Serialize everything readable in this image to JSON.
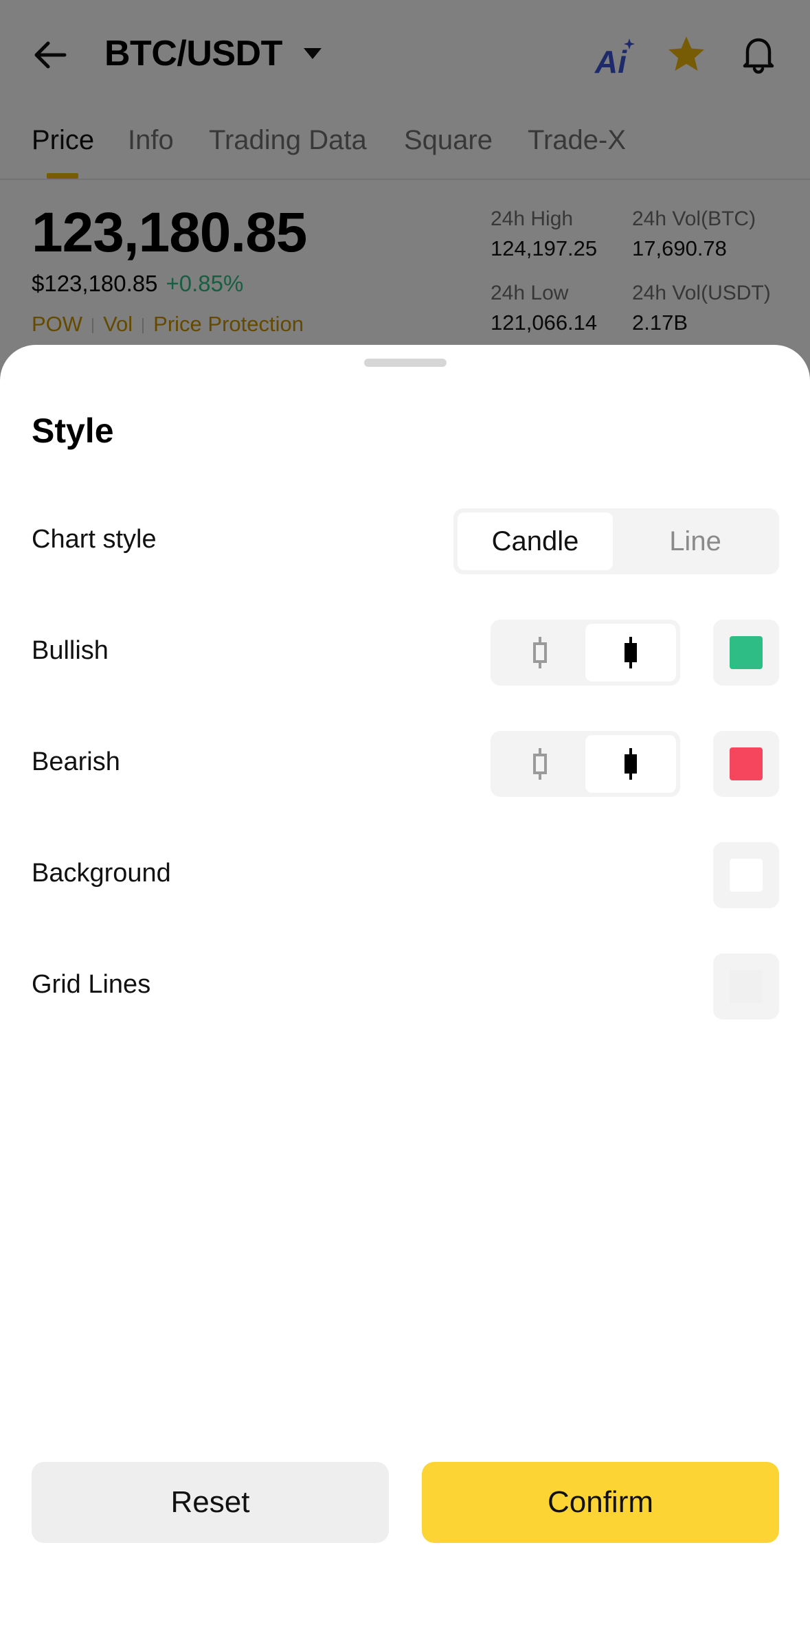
{
  "header": {
    "pair": "BTC/USDT",
    "icons": [
      "back-arrow-icon",
      "caret-down-icon",
      "ai-icon",
      "star-icon",
      "bell-icon"
    ]
  },
  "tabs": [
    {
      "label": "Price",
      "active": true
    },
    {
      "label": "Info",
      "active": false
    },
    {
      "label": "Trading Data",
      "active": false
    },
    {
      "label": "Square",
      "active": false
    },
    {
      "label": "Trade-X",
      "active": false
    }
  ],
  "ticker": {
    "last_price": "123,180.85",
    "fiat_price": "$123,180.85",
    "change": "+0.85%",
    "tags": [
      "POW",
      "Vol",
      "Price Protection"
    ],
    "stats": {
      "high_label": "24h High",
      "high_value": "124,197.25",
      "vol_btc_label": "24h Vol(BTC)",
      "vol_btc_value": "17,690.78",
      "low_label": "24h Low",
      "low_value": "121,066.14",
      "vol_usdt_label": "24h Vol(USDT)",
      "vol_usdt_value": "2.17B"
    }
  },
  "sheet": {
    "title": "Style",
    "chart_style": {
      "label": "Chart style",
      "options": [
        "Candle",
        "Line"
      ],
      "selected": "Candle"
    },
    "bullish": {
      "label": "Bullish",
      "color": "#2ebd85",
      "candle_style": "solid"
    },
    "bearish": {
      "label": "Bearish",
      "color": "#f6465d",
      "candle_style": "solid"
    },
    "background": {
      "label": "Background",
      "color": "#ffffff"
    },
    "grid_lines": {
      "label": "Grid Lines",
      "color": "#f0f0f0"
    },
    "reset_label": "Reset",
    "confirm_label": "Confirm"
  },
  "colors": {
    "accent": "#f0b90b",
    "up": "#2ebd85",
    "down": "#f6465d",
    "confirm_button": "#fcd535"
  }
}
